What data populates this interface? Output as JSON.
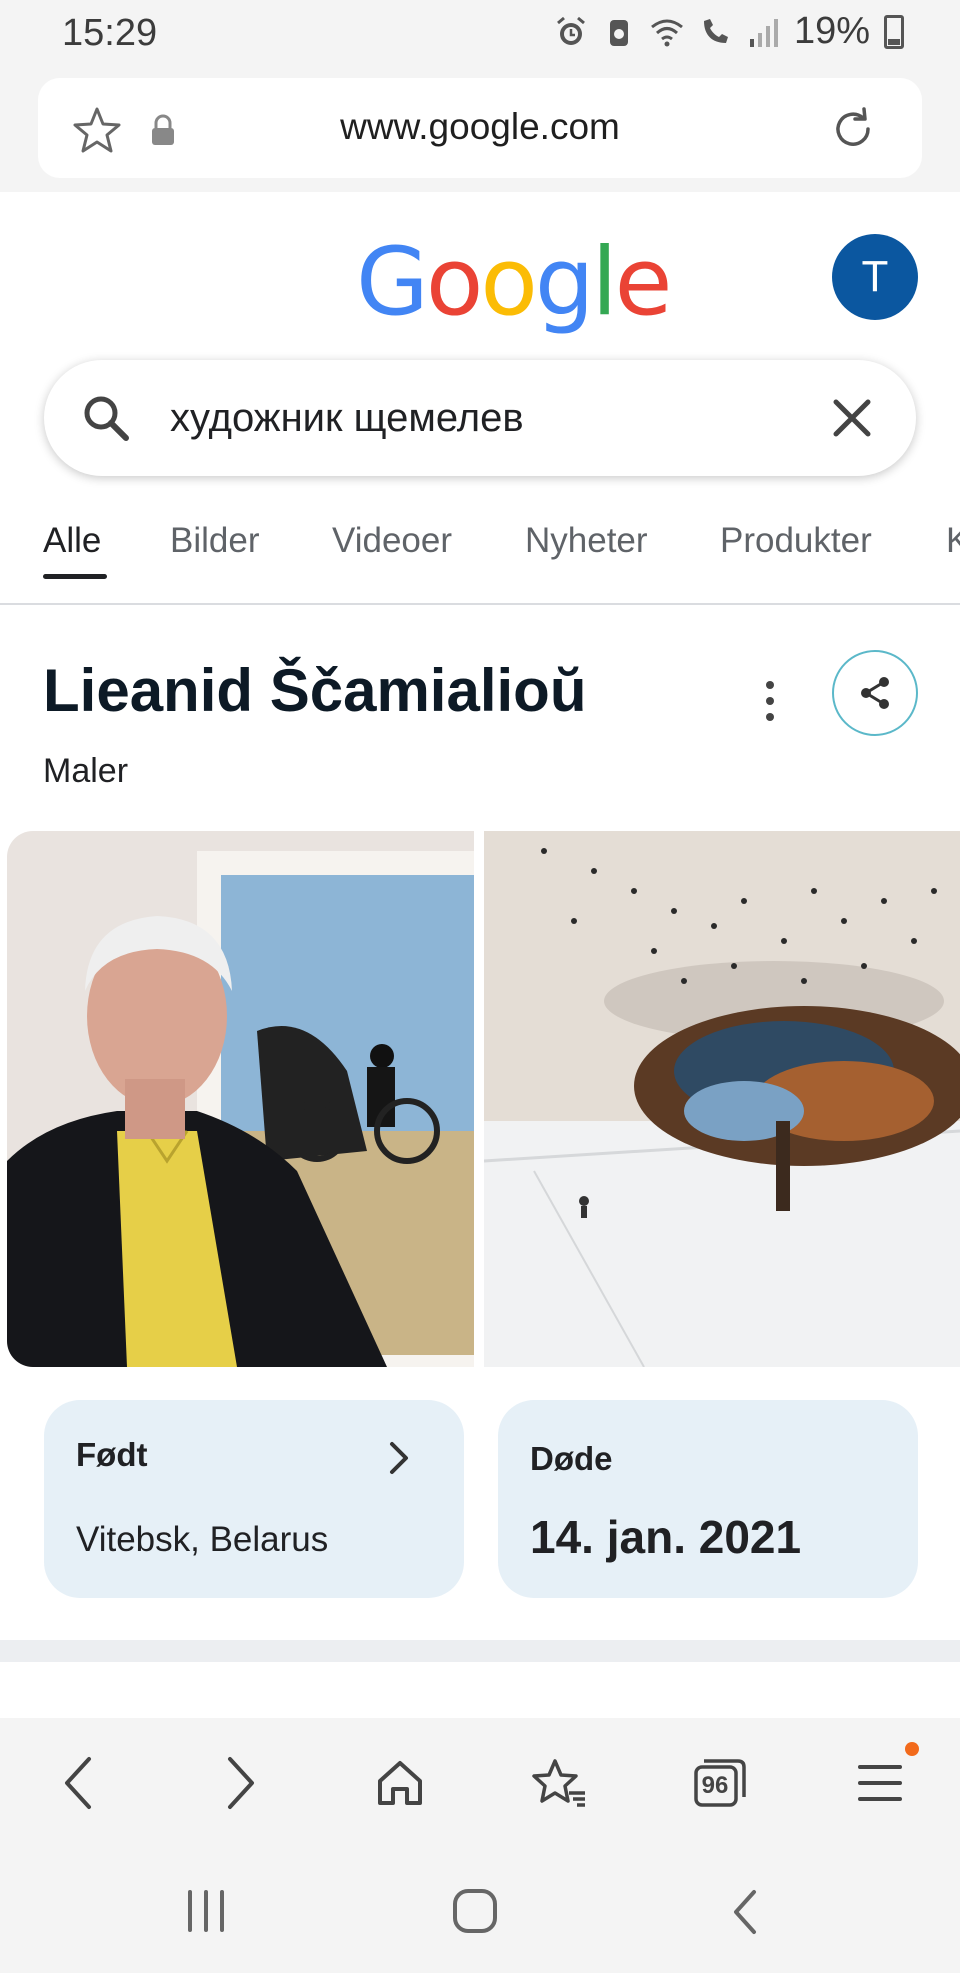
{
  "status_bar": {
    "time": "15:29",
    "battery": "19%"
  },
  "browser": {
    "url": "www.google.com",
    "tab_count": "96"
  },
  "google": {
    "logo_letters": [
      "G",
      "o",
      "o",
      "g",
      "l",
      "e"
    ],
    "avatar_letter": "T"
  },
  "search": {
    "query": "художник щемелев"
  },
  "tabs": [
    {
      "label": "Alle",
      "active": true
    },
    {
      "label": "Bilder",
      "active": false
    },
    {
      "label": "Videoer",
      "active": false
    },
    {
      "label": "Nyheter",
      "active": false
    },
    {
      "label": "Produkter",
      "active": false
    },
    {
      "label": "K",
      "active": false
    }
  ],
  "knowledge_panel": {
    "title": "Lieanid Ščamialioŭ",
    "subtitle": "Maler",
    "born": {
      "label": "Født",
      "value": "Vitebsk, Belarus"
    },
    "died": {
      "label": "Døde",
      "value": "14. jan. 2021"
    }
  },
  "colors": {
    "google_blue": "#4285f4",
    "google_red": "#ea4335",
    "google_yellow": "#fbbc05",
    "google_green": "#34a853",
    "avatar_bg": "#0b57a0",
    "card_bg": "#e6f0f7",
    "notification_dot": "#f26a1b"
  }
}
